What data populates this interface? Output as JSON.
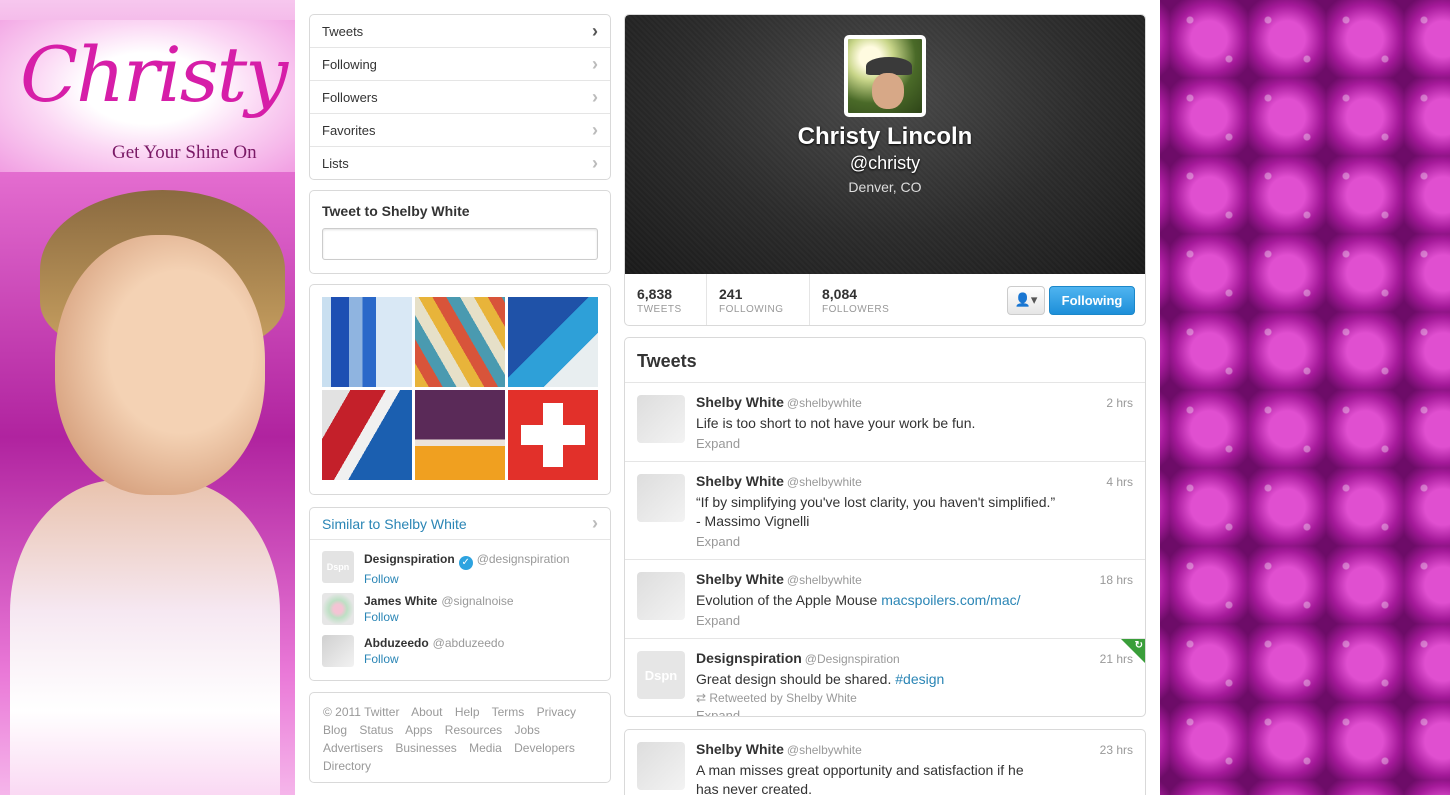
{
  "promo": {
    "logo_text": "Christy",
    "tagline": "Get Your Shine On"
  },
  "nav": {
    "items": [
      {
        "label": "Tweets"
      },
      {
        "label": "Following"
      },
      {
        "label": "Followers"
      },
      {
        "label": "Favorites"
      },
      {
        "label": "Lists"
      }
    ]
  },
  "tweet_to": {
    "title": "Tweet to Shelby White",
    "placeholder": ""
  },
  "similar": {
    "title": "Similar to Shelby White",
    "follow_label": "Follow",
    "users": [
      {
        "name": "Designspiration",
        "handle": "@designspiration",
        "verified": true,
        "avatar_text": "Dspn"
      },
      {
        "name": "James White",
        "handle": "@signalnoise",
        "verified": false,
        "avatar_text": ""
      },
      {
        "name": "Abduzeedo",
        "handle": "@abduzeedo",
        "verified": false,
        "avatar_text": ""
      }
    ]
  },
  "footer": {
    "links": [
      "© 2011 Twitter",
      "About",
      "Help",
      "Terms",
      "Privacy",
      "Blog",
      "Status",
      "Apps",
      "Resources",
      "Jobs",
      "Advertisers",
      "Businesses",
      "Media",
      "Developers",
      "Directory"
    ]
  },
  "profile": {
    "name": "Christy Lincoln",
    "handle": "@christy",
    "location": "Denver, CO",
    "stats": [
      {
        "num": "6,838",
        "label": "TWEETS"
      },
      {
        "num": "241",
        "label": "FOLLOWING"
      },
      {
        "num": "8,084",
        "label": "FOLLOWERS"
      }
    ],
    "following_button": "Following",
    "user_menu_icon": "user-dropdown-icon"
  },
  "tweets": {
    "title": "Tweets",
    "expand_label": "Expand",
    "items": [
      {
        "name": "Shelby White",
        "handle": "@shelbywhite",
        "time": "2 hrs",
        "text": "Life is too short to not have your work be fun."
      },
      {
        "name": "Shelby White",
        "handle": "@shelbywhite",
        "time": "4 hrs",
        "text": "“If by simplifying you've lost clarity, you haven't simplified.”",
        "text2": "- Massimo Vignelli"
      },
      {
        "name": "Shelby White",
        "handle": "@shelbywhite",
        "time": "18 hrs",
        "text": "Evolution of the Apple Mouse ",
        "link": "macspoilers.com/mac/"
      },
      {
        "name": "Designspiration",
        "handle": "@Designspiration",
        "time": "21 hrs",
        "text": "Great design should be shared. ",
        "link": "#design",
        "retweet": "Retweeted by Shelby White",
        "avatar_text": "Dspn"
      }
    ],
    "next": {
      "name": "Shelby White",
      "handle": "@shelbywhite",
      "time": "23 hrs",
      "text": "A man misses great opportunity and satisfaction if he",
      "text2": "has never created."
    }
  }
}
